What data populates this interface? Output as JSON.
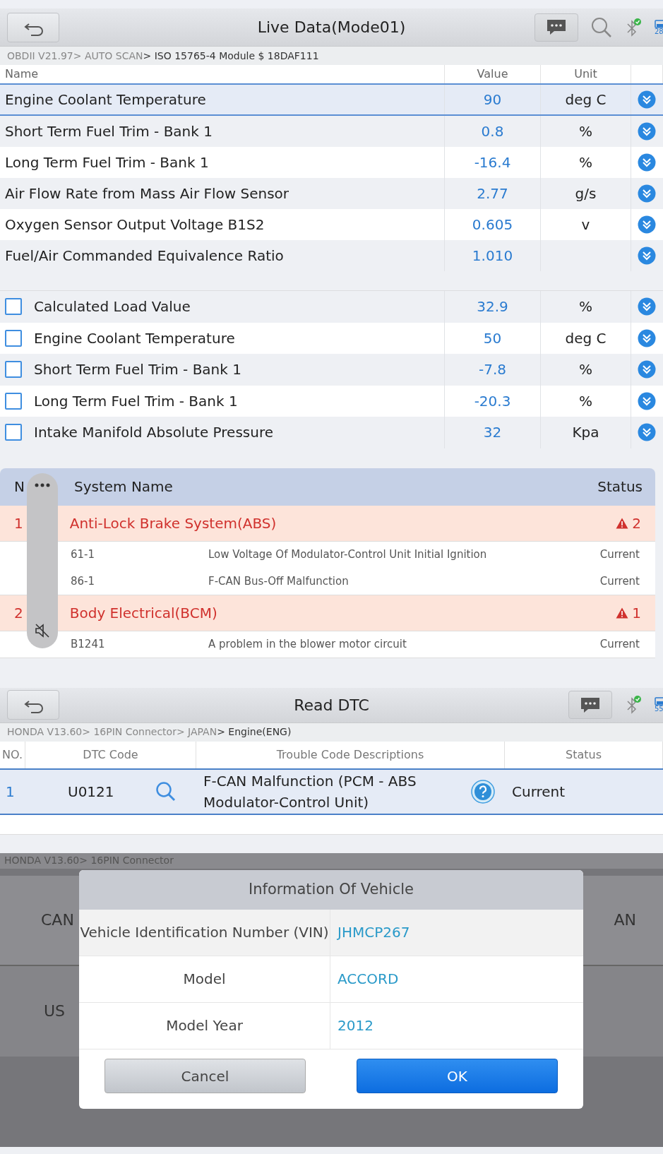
{
  "live_data": {
    "title": "Live Data(Mode01)",
    "breadcrumb": {
      "path": "OBDII V21.97> AUTO SCAN",
      "current": "> ISO 15765-4 Module $ 18DAF111"
    },
    "battery": "28",
    "columns": [
      "Name",
      "Value",
      "Unit"
    ],
    "rows": [
      {
        "name": "Engine Coolant Temperature",
        "value": "90",
        "unit": "deg C",
        "selected": true
      },
      {
        "name": "Short Term Fuel Trim - Bank 1",
        "value": "0.8",
        "unit": "%",
        "selected": false
      },
      {
        "name": "Long Term Fuel Trim - Bank 1",
        "value": "-16.4",
        "unit": "%",
        "selected": false
      },
      {
        "name": "Air Flow Rate from Mass Air Flow Sensor",
        "value": "2.77",
        "unit": "g/s",
        "selected": false
      },
      {
        "name": "Oxygen Sensor Output Voltage B1S2",
        "value": "0.605",
        "unit": "v",
        "selected": false
      },
      {
        "name": "Fuel/Air Commanded Equivalence Ratio",
        "value": "1.010",
        "selected": false
      }
    ],
    "checkbox_rows": [
      {
        "name": "Calculated Load Value",
        "value": "32.9",
        "unit": "%",
        "checked": false
      },
      {
        "name": "Engine Coolant Temperature",
        "value": "50",
        "unit": "deg C",
        "checked": false
      },
      {
        "name": "Short Term Fuel Trim - Bank 1",
        "value": "-7.8",
        "unit": "%",
        "checked": false
      },
      {
        "name": "Long Term Fuel Trim - Bank 1",
        "value": "-20.3",
        "unit": "%",
        "checked": false
      },
      {
        "name": "Intake Manifold Absolute Pressure",
        "value": "32",
        "unit": "Kpa",
        "checked": false
      }
    ]
  },
  "fault_list": {
    "columns": [
      "N",
      "System Name",
      "Status"
    ],
    "systems": [
      {
        "number": "1",
        "name": "Anti-Lock Brake System(ABS)",
        "count": "2",
        "codes": [
          {
            "code": "61-1",
            "description": "Low Voltage Of Modulator-Control Unit Initial Ignition",
            "status": "Current"
          },
          {
            "code": "86-1",
            "description": "F-CAN Bus-Off Malfunction",
            "status": "Current"
          }
        ]
      },
      {
        "number": "2",
        "name": "Body Electrical(BCM)",
        "count": "1",
        "codes": [
          {
            "code": "B1241",
            "description": "A problem in the blower motor circuit",
            "status": "Current"
          }
        ]
      }
    ]
  },
  "read_dtc": {
    "title": "Read DTC",
    "breadcrumb": {
      "path": "HONDA V13.60> 16PIN Connector> JAPAN",
      "current": "> Engine(ENG)"
    },
    "battery": "55",
    "columns": [
      "NO.",
      "DTC Code",
      "Trouble Code Descriptions",
      "Status"
    ],
    "rows": [
      {
        "number": "1",
        "code": "U0121",
        "description": "F-CAN Malfunction (PCM - ABS Modulator-Control Unit)",
        "status": "Current"
      }
    ]
  },
  "vehicle_dialog": {
    "background": {
      "breadcrumb": "HONDA V13.60> 16PIN Connector",
      "left_labels": [
        "CAN",
        "US"
      ],
      "right_label": "AN"
    },
    "title": "Information Of Vehicle",
    "fields": [
      {
        "label": "Vehicle Identification Number (VIN)",
        "value": "JHMCP267"
      },
      {
        "label": "Model",
        "value": "ACCORD"
      },
      {
        "label": "Model Year",
        "value": "2012"
      }
    ],
    "buttons": [
      {
        "label": "Cancel",
        "kind": "secondary"
      },
      {
        "label": "OK",
        "kind": "primary"
      }
    ]
  }
}
